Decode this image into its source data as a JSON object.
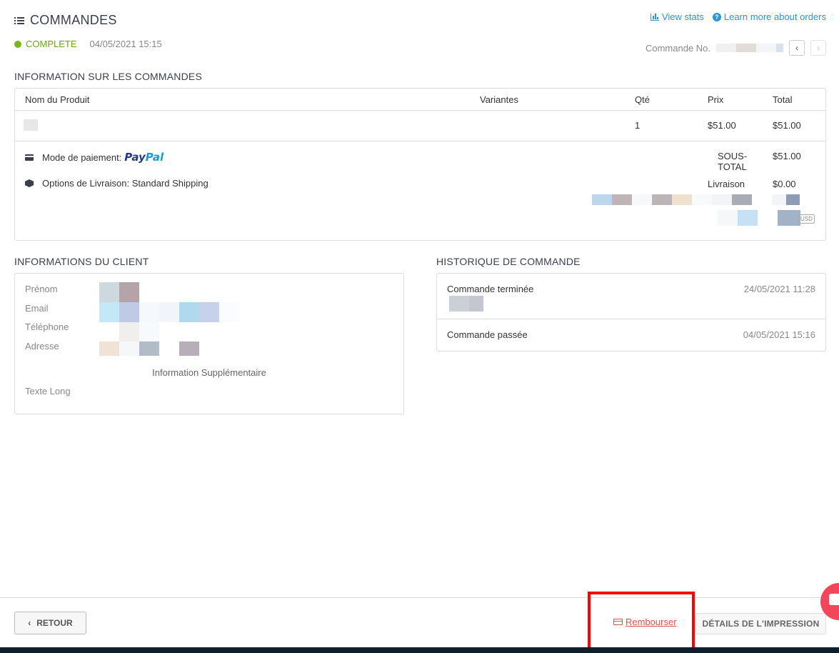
{
  "header": {
    "title": "COMMANDES",
    "status": "COMPLETE",
    "date": "04/05/2021 15:15",
    "links": {
      "view_stats": "View stats",
      "learn_more": "Learn more about orders"
    },
    "order_no_label": "Commande No."
  },
  "order_info": {
    "title": "INFORMATION SUR LES COMMANDES",
    "columns": {
      "product": "Nom du Produit",
      "variants": "Variantes",
      "qty": "Qté",
      "price": "Prix",
      "total": "Total"
    },
    "items": [
      {
        "qty": "1",
        "price": "$51.00",
        "total": "$51.00"
      }
    ],
    "payment_label": "Mode de paiement:",
    "payment_brand_part1": "Pay",
    "payment_brand_part2": "Pal",
    "shipping_label": "Options de Livraison: Standard Shipping",
    "subtotal_label": "SOUS-TOTAL",
    "subtotal_value": "$51.00",
    "shipping_cost_label": "Livraison",
    "shipping_cost_value": "$0.00",
    "currency": "USD"
  },
  "client": {
    "title": "INFORMATIONS DU CLIENT",
    "fields": {
      "first_name": "Prénom",
      "email": "Email",
      "phone": "Téléphone",
      "address": "Adresse"
    },
    "extra_title": "Information Supplémentaire",
    "long_text": "Texte Long"
  },
  "history": {
    "title": "HISTORIQUE DE COMMANDE",
    "events": [
      {
        "name": "Commande terminée",
        "time": "24/05/2021 11:28"
      },
      {
        "name": "Commande passée",
        "time": "04/05/2021 15:16"
      }
    ]
  },
  "footer": {
    "back_label": "RETOUR",
    "refund_label": "Rembourser",
    "print_label": "DÉTAILS DE L'IMPRESSION"
  }
}
